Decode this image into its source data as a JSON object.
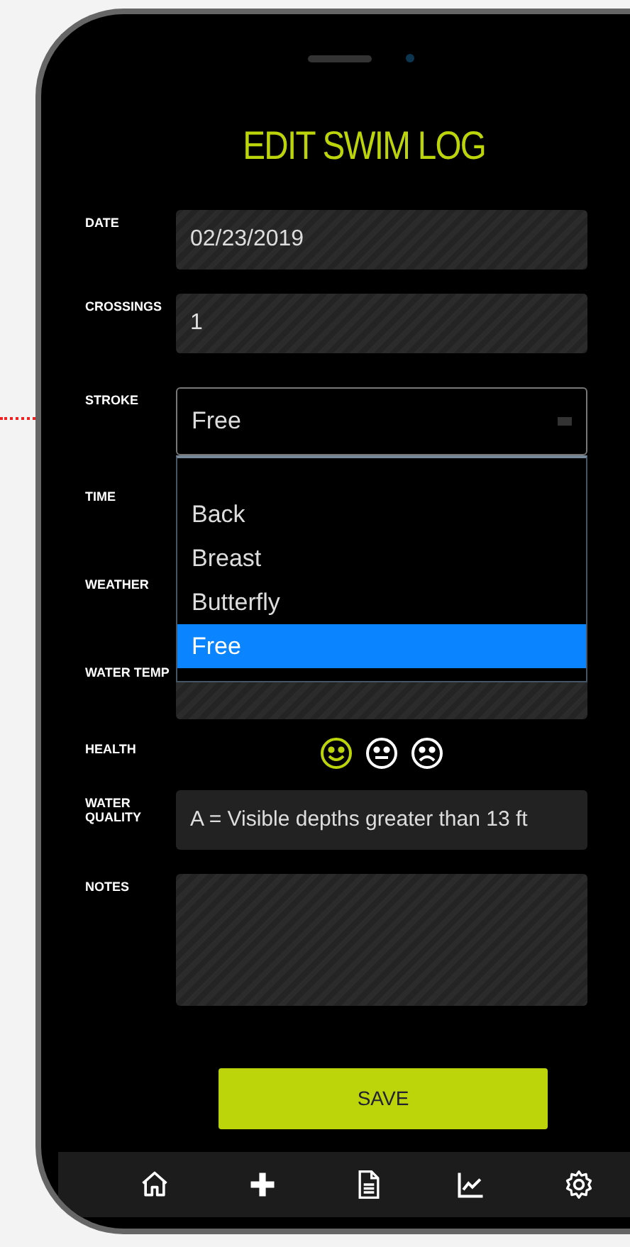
{
  "screen": {
    "title": "EDIT SWIM LOG"
  },
  "fields": [
    {
      "label": "DATE",
      "kind": "text",
      "value": "02/23/2019"
    },
    {
      "label": "CROSSINGS",
      "kind": "text",
      "value": "1"
    },
    {
      "label": "STROKE",
      "kind": "select",
      "value": "Free",
      "expanded": true,
      "options": [
        {
          "label": "Back",
          "selected": false
        },
        {
          "label": "Breast",
          "selected": false
        },
        {
          "label": "Butterfly",
          "selected": false
        },
        {
          "label": "Free",
          "selected": true
        }
      ]
    },
    {
      "label": "TIME",
      "kind": "text"
    },
    {
      "label": "WEATHER",
      "kind": "text"
    },
    {
      "label": "WATER TEMP",
      "kind": "text"
    },
    {
      "label": "HEALTH",
      "kind": "faces",
      "options": [
        {
          "selected": true
        },
        {
          "selected": false
        },
        {
          "selected": false
        }
      ]
    },
    {
      "label": "WATER QUALITY",
      "kind": "text",
      "value": "A = Visible depths greater than 13 ft"
    },
    {
      "label": "NOTES",
      "kind": "textarea"
    }
  ],
  "save_button": "SAVE"
}
